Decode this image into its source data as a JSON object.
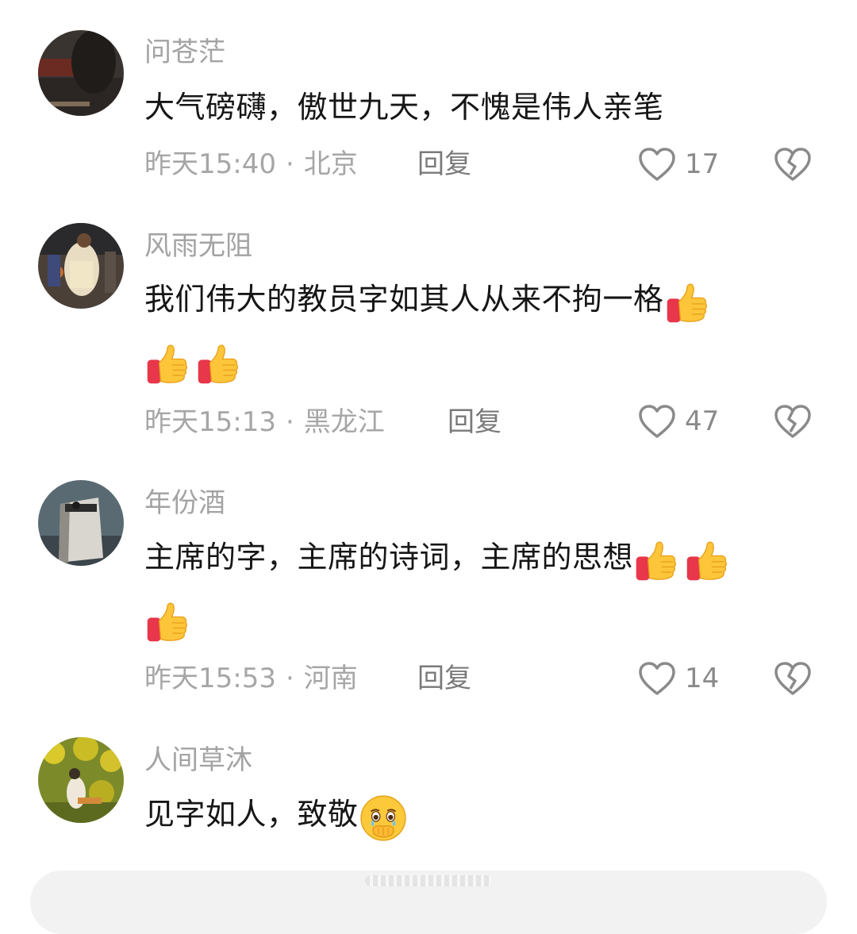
{
  "comments": [
    {
      "username": "问苍茫",
      "text": "大气磅礴，傲世九天，不愧是伟人亲笔",
      "time": "昨天15:40",
      "location": "北京",
      "reply_label": "回复",
      "likes": "17"
    },
    {
      "username": "风雨无阻",
      "text": "我们伟大的教员字如其人从来不拘一格",
      "time": "昨天15:13",
      "location": "黑龙江",
      "reply_label": "回复",
      "likes": "47"
    },
    {
      "username": "年份酒",
      "text": "主席的字，主席的诗词，主席的思想",
      "time": "昨天15:53",
      "location": "河南",
      "reply_label": "回复",
      "likes": "14"
    },
    {
      "username": "人间草沐",
      "text": "见字如人，致敬"
    }
  ],
  "meta_separator": "·",
  "icons": {
    "like": "heart-outline-icon",
    "dislike": "broken-heart-icon",
    "thumbs_up": "thumbs-up-emoji",
    "teary": "holding-back-tears-emoji"
  },
  "colors": {
    "username": "#a3a3a3",
    "content": "#161616",
    "meta": "#a6a6a6",
    "icon": "#8a8a8a"
  }
}
